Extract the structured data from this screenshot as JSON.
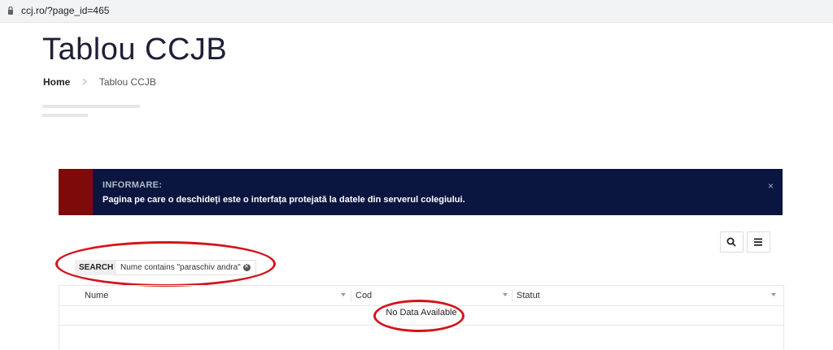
{
  "browser": {
    "url": "ccj.ro/?page_id=465"
  },
  "page": {
    "title": "Tablou CCJB"
  },
  "breadcrumb": {
    "home": "Home",
    "current": "Tablou CCJB"
  },
  "banner": {
    "heading": "INFORMARE:",
    "message": "Pagina pe care o deschideți este o interfața protejată la datele din serverul colegiului.",
    "close": "×",
    "colors": {
      "background": "#0b1640",
      "accent_strip": "#7e0a0a"
    }
  },
  "toolbar": {
    "search_icon": "search-icon",
    "menu_icon": "menu-icon"
  },
  "search": {
    "label": "SEARCH",
    "filter": "Nume contains \"paraschiv andra\""
  },
  "grid": {
    "columns": [
      "Nume",
      "Cod",
      "Statut"
    ],
    "empty_message": "No Data Available"
  },
  "annotations": {
    "color": "#d3141b"
  }
}
